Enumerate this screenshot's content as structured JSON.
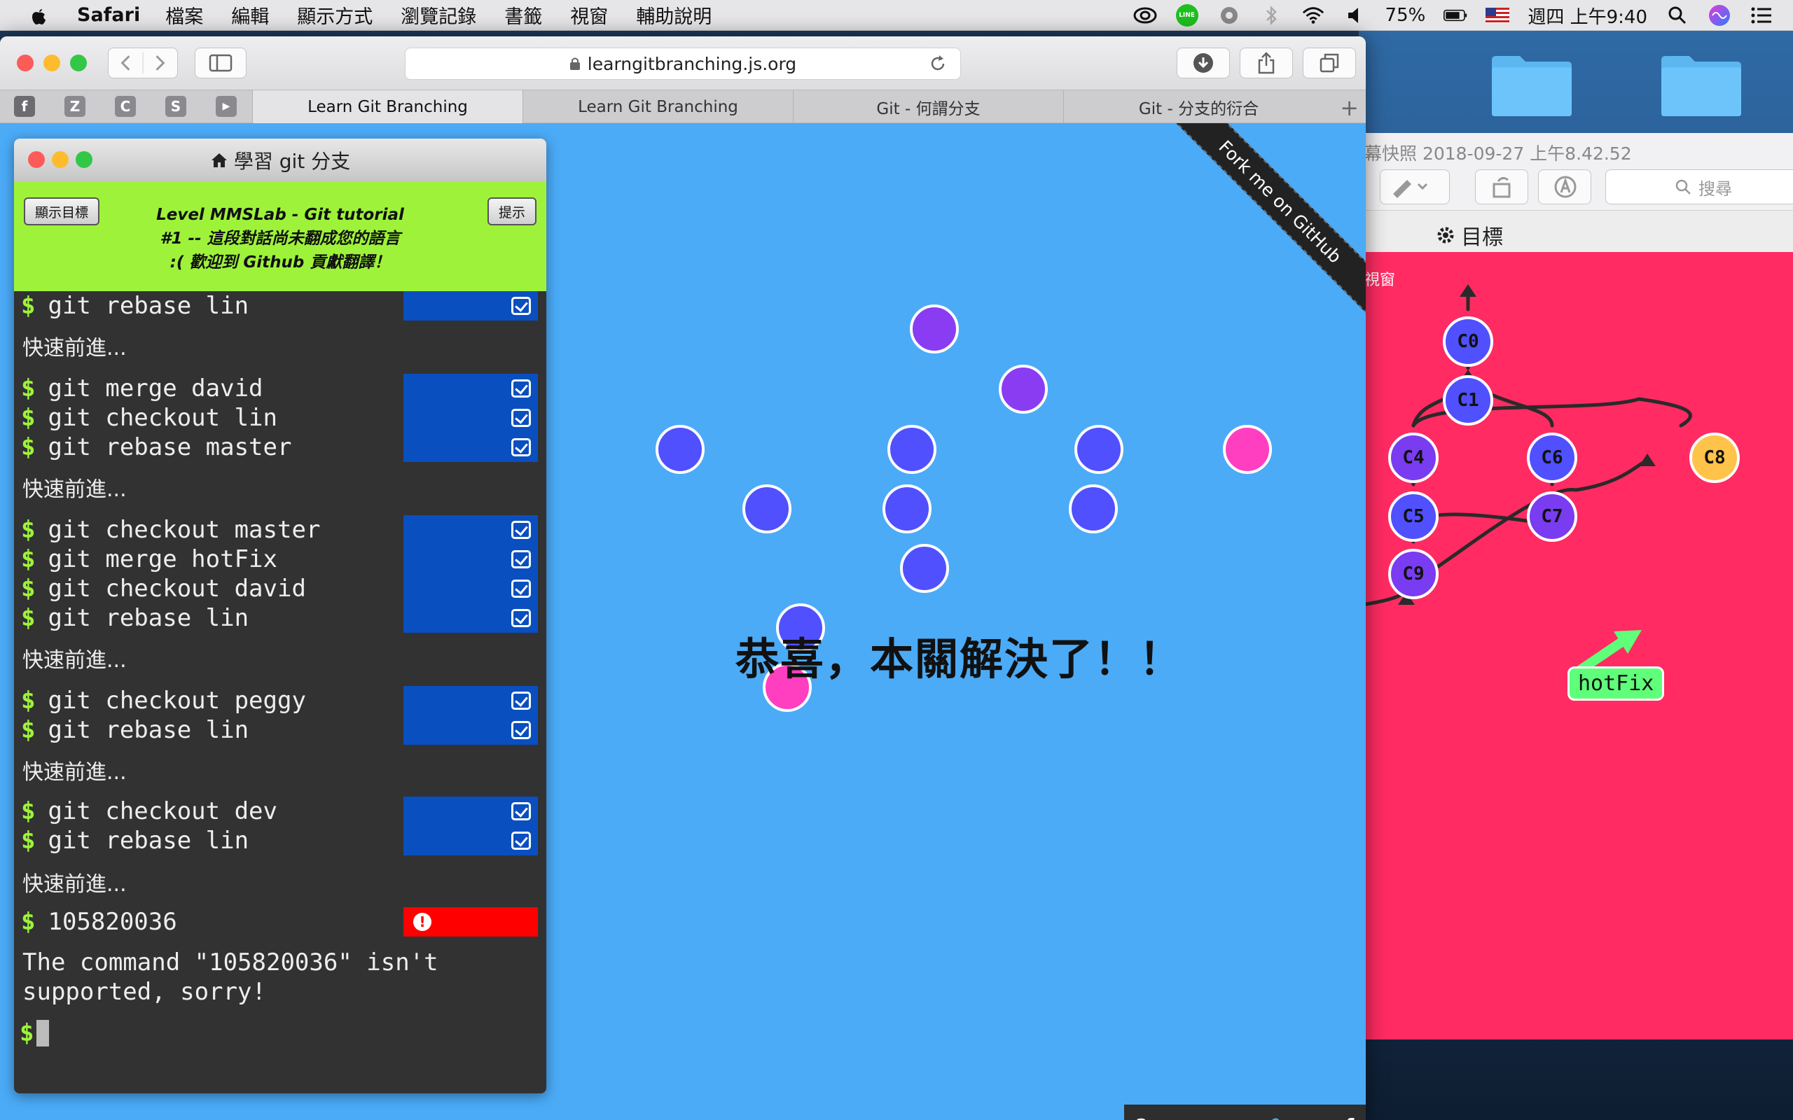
{
  "menubar": {
    "app_name": "Safari",
    "items": [
      "檔案",
      "編輯",
      "顯示方式",
      "瀏覽記錄",
      "書籤",
      "視窗",
      "輔助說明"
    ],
    "battery": "75%",
    "clock": "週四 上午9:40",
    "line_badge": "LINE"
  },
  "safari": {
    "url": "learngitbranching.js.org",
    "pinned_tabs": [
      "f",
      "Z",
      "C",
      "S",
      "▶"
    ],
    "tabs": [
      {
        "label": "Learn Git Branching",
        "active": true
      },
      {
        "label": "Learn Git Branching",
        "active": false
      },
      {
        "label": "Git - 何謂分支",
        "active": false
      },
      {
        "label": "Git - 分支的衍合",
        "active": false
      }
    ]
  },
  "ribbon": {
    "text": "Fork me on GitHub"
  },
  "level_window": {
    "title": "學習 git 分支",
    "show_goal_button": "顯示目標",
    "hint_button": "提示",
    "level_line1": "Level MMSLab - Git tutorial",
    "level_line2": "#1 -- 這段對話尚未翻成您的語言",
    "level_line3": ":( 歡迎到 Github 貢獻翻譯！"
  },
  "terminal": {
    "groups": [
      {
        "commands": [
          "git rebase lin"
        ]
      },
      {
        "commands": [
          "git merge david",
          "git checkout lin",
          "git rebase master"
        ]
      },
      {
        "commands": [
          "git checkout master",
          "git merge hotFix",
          "git checkout david",
          "git rebase lin"
        ]
      },
      {
        "commands": [
          "git checkout peggy",
          "git rebase lin"
        ]
      },
      {
        "commands": [
          "git checkout dev",
          "git rebase lin"
        ]
      }
    ],
    "fast_forward": "快速前進...",
    "error_command": "105820036",
    "error_message": "The command \"105820036\" isn't supported, sorry!",
    "prompt": "$"
  },
  "visualization": {
    "success_message": "恭喜，本關解決了！！",
    "colors": {
      "blue": "#5050ff",
      "purple": "#8a3cf2",
      "magenta": "#ff3ec0",
      "background": "#4babf7"
    }
  },
  "bottom_bar": {
    "icons": [
      "help-icon",
      "globe-icon",
      "twitter-icon",
      "facebook-icon"
    ],
    "labels": [
      "?",
      "◕",
      "🐦",
      "f"
    ]
  },
  "preview": {
    "title": "幕快照 2018-09-27 上午8.42.52",
    "search_placeholder": "搜尋",
    "goal_label": "目標",
    "viewport_label": "視窗",
    "nodes": [
      "C0",
      "C1",
      "C4",
      "C6",
      "C8",
      "C5",
      "C7",
      "C9"
    ],
    "branch_label": "hotFix",
    "colors": {
      "background": "#ff2b62",
      "node": "#5050ff",
      "node_purple": "#7a3cf0",
      "head": "#ffc34a",
      "branch": "#5fff7a"
    }
  }
}
